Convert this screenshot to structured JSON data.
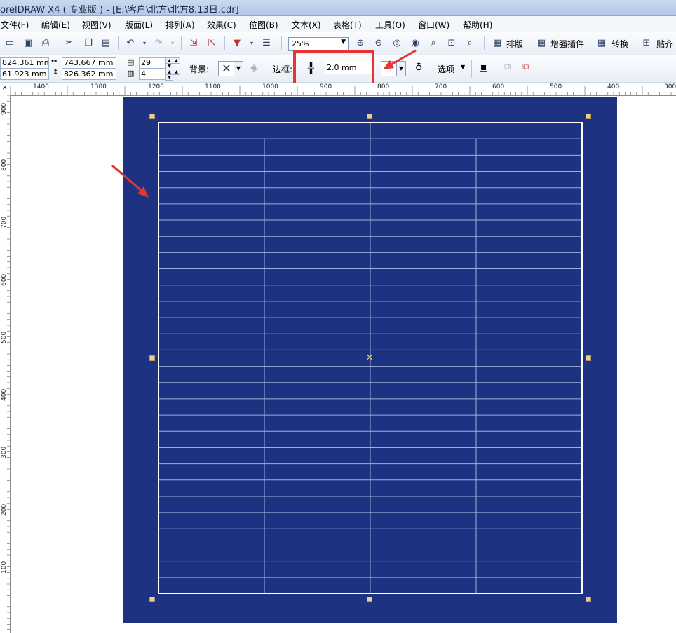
{
  "window": {
    "title": "orelDRAW X4 ( 专业版 ) - [E:\\客户\\北方\\北方8.13日.cdr]"
  },
  "menu": [
    "文件(F)",
    "编辑(E)",
    "视图(V)",
    "版面(L)",
    "排列(A)",
    "效果(C)",
    "位图(B)",
    "文本(X)",
    "表格(T)",
    "工具(O)",
    "窗口(W)",
    "帮助(H)"
  ],
  "toolbar": {
    "zoom": "25%",
    "plugins": [
      "排版",
      "增强插件",
      "转换",
      "贴齐"
    ]
  },
  "property_bar": {
    "x": "824.361 mm",
    "y": "61.923 mm",
    "width": "743.667 mm",
    "height": "826.362 mm",
    "rows": "29",
    "cols": "4",
    "background_label": "背景:",
    "border_label": "边框:",
    "border_width": "2.0 mm",
    "options_label": "选项"
  },
  "ruler": {
    "h_labels": [
      "1400",
      "1300",
      "1200",
      "1100",
      "1000",
      "900",
      "800",
      "700",
      "600",
      "500",
      "400",
      "300"
    ],
    "v_labels": [
      "900",
      "800",
      "700",
      "600",
      "500",
      "400",
      "300",
      "200",
      "100"
    ]
  },
  "colors": {
    "page": "#1e3282",
    "highlight": "#e53434",
    "table_line": "#9fb0dd"
  },
  "table": {
    "rows": 29,
    "cols": 4,
    "border_color": "#ffffff"
  }
}
